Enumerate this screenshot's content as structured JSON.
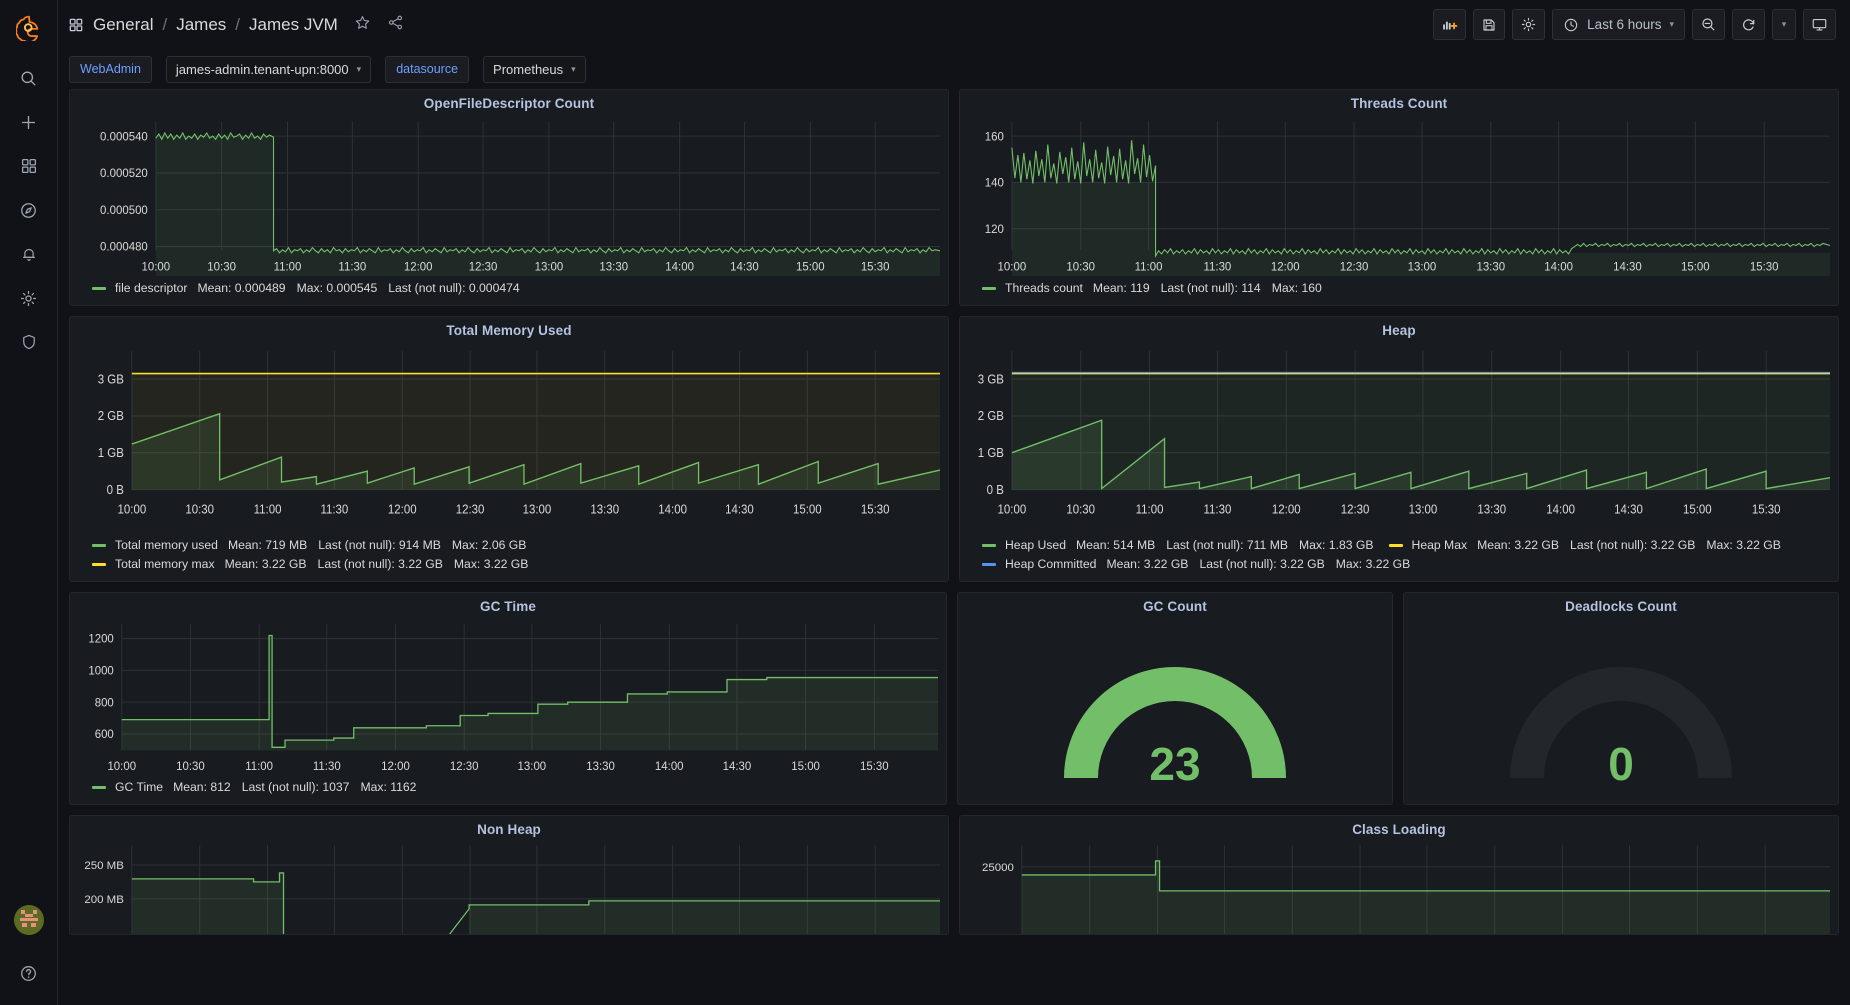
{
  "sidebar": {
    "brand_icon": "grafana-logo-icon",
    "items": [
      {
        "icon": "search-icon",
        "label": "Search"
      },
      {
        "icon": "plus-icon",
        "label": "Create"
      },
      {
        "icon": "dashboards-grid-icon",
        "label": "Dashboards"
      },
      {
        "icon": "compass-explore-icon",
        "label": "Explore"
      },
      {
        "icon": "bell-alerting-icon",
        "label": "Alerting"
      },
      {
        "icon": "gear-configuration-icon",
        "label": "Configuration"
      },
      {
        "icon": "shield-server-admin-icon",
        "label": "Server Admin"
      }
    ],
    "avatar": {
      "icon": "user-avatar",
      "label": "Profile"
    },
    "help": {
      "icon": "help-circle-icon",
      "label": "Help"
    }
  },
  "header": {
    "folder_icon": "dashboard-grid-icon",
    "breadcrumb": [
      "General",
      "James",
      "James JVM"
    ],
    "separator": "/",
    "star_icon": "star-icon",
    "share_icon": "share-icon",
    "toolbar": {
      "add_panel_icon": "add-panel-icon",
      "save_icon": "save-dashboard-icon",
      "settings_icon": "dashboard-settings-gear-icon",
      "time_icon": "clock-icon",
      "time_range": "Last 6 hours",
      "time_caret": "chevron-down-icon",
      "zoom_out_icon": "zoom-out-magnifier-icon",
      "refresh_icon": "refresh-cycle-icon",
      "refresh_caret": "chevron-down-icon",
      "kiosk_icon": "tv-kiosk-icon"
    }
  },
  "variables": [
    {
      "label": "WebAdmin",
      "value": "james-admin.tenant-upn:8000",
      "caret": "chevron-down-icon"
    },
    {
      "label": "datasource",
      "value": "Prometheus",
      "caret": "chevron-down-icon"
    }
  ],
  "chart_data": [
    {
      "type": "line",
      "title": "OpenFileDescriptor Count",
      "xlabel": "",
      "ylabel": "",
      "x_ticks": [
        "10:00",
        "10:30",
        "11:00",
        "11:30",
        "12:00",
        "12:30",
        "13:00",
        "13:30",
        "14:00",
        "14:30",
        "15:00",
        "15:30"
      ],
      "y_ticks": [
        "0.000480",
        "0.000500",
        "0.000520",
        "0.000540"
      ],
      "ylim": [
        0.00047,
        0.000548
      ],
      "grid": true,
      "legend_position": "bottom",
      "series": [
        {
          "name": "file descriptor",
          "color": "#73bf69",
          "stats": [
            {
              "label": "Mean",
              "value": "0.000489"
            },
            {
              "label": "Max",
              "value": "0.000545"
            },
            {
              "label": "Last (not null)",
              "value": "0.000474"
            }
          ],
          "note": "flat ~0.000540 noisy until 11:07, step down to ~0.000476 noisy through 15:45"
        }
      ]
    },
    {
      "type": "line",
      "title": "Threads Count",
      "xlabel": "",
      "ylabel": "",
      "x_ticks": [
        "10:00",
        "10:30",
        "11:00",
        "11:30",
        "12:00",
        "12:30",
        "13:00",
        "13:30",
        "14:00",
        "14:30",
        "15:00",
        "15:30"
      ],
      "y_ticks": [
        "120",
        "140",
        "160"
      ],
      "ylim": [
        105,
        165
      ],
      "grid": true,
      "legend_position": "bottom",
      "series": [
        {
          "name": "Threads count",
          "color": "#73bf69",
          "stats": [
            {
              "label": "Mean",
              "value": "119"
            },
            {
              "label": "Last (not null)",
              "value": "114"
            },
            {
              "label": "Max",
              "value": "160"
            }
          ],
          "note": "spiky 140-160 until 11:07, drop to ~110 flat, small step up to ~114 at 13:50"
        }
      ]
    },
    {
      "type": "area",
      "title": "Total Memory Used",
      "xlabel": "",
      "ylabel": "",
      "x_ticks": [
        "10:00",
        "10:30",
        "11:00",
        "11:30",
        "12:00",
        "12:30",
        "13:00",
        "13:30",
        "14:00",
        "14:30",
        "15:00",
        "15:30"
      ],
      "y_ticks": [
        "0 B",
        "1 GB",
        "2 GB",
        "3 GB"
      ],
      "ylim": [
        0,
        3.45
      ],
      "grid": true,
      "legend_position": "bottom",
      "series": [
        {
          "name": "Total memory used",
          "color": "#73bf69",
          "stats": [
            {
              "label": "Mean",
              "value": "719 MB"
            },
            {
              "label": "Last (not null)",
              "value": "914 MB"
            },
            {
              "label": "Max",
              "value": "2.06 GB"
            }
          ],
          "note": "GC sawtooth, two large teeth to 2.06 GB and 1.85 GB, then smaller teeth ~0.6-0.9 GB"
        },
        {
          "name": "Total memory max",
          "color": "#fade2a",
          "stats": [
            {
              "label": "Mean",
              "value": "3.22 GB"
            },
            {
              "label": "Last (not null)",
              "value": "3.22 GB"
            },
            {
              "label": "Max",
              "value": "3.22 GB"
            }
          ],
          "note": "flat line at 3.22 GB"
        }
      ]
    },
    {
      "type": "area",
      "title": "Heap",
      "xlabel": "",
      "ylabel": "",
      "x_ticks": [
        "10:00",
        "10:30",
        "11:00",
        "11:30",
        "12:00",
        "12:30",
        "13:00",
        "13:30",
        "14:00",
        "14:30",
        "15:00",
        "15:30"
      ],
      "y_ticks": [
        "0 B",
        "1 GB",
        "2 GB",
        "3 GB"
      ],
      "ylim": [
        0,
        3.45
      ],
      "grid": true,
      "legend_position": "bottom",
      "series": [
        {
          "name": "Heap Used",
          "color": "#73bf69",
          "stats": [
            {
              "label": "Mean",
              "value": "514 MB"
            },
            {
              "label": "Last (not null)",
              "value": "711 MB"
            },
            {
              "label": "Max",
              "value": "1.83 GB"
            }
          ],
          "note": "GC sawtooth peaking 1.83 GB then smaller teeth"
        },
        {
          "name": "Heap Max",
          "color": "#fade2a",
          "stats": [
            {
              "label": "Mean",
              "value": "3.22 GB"
            },
            {
              "label": "Last (not null)",
              "value": "3.22 GB"
            },
            {
              "label": "Max",
              "value": "3.22 GB"
            }
          ],
          "note": "flat line at 3.22 GB"
        },
        {
          "name": "Heap Committed",
          "color": "#5794f2",
          "stats": [
            {
              "label": "Mean",
              "value": "3.22 GB"
            },
            {
              "label": "Last (not null)",
              "value": "3.22 GB"
            },
            {
              "label": "Max",
              "value": "3.22 GB"
            }
          ],
          "note": "flat line at 3.22 GB overlapping Heap Max"
        }
      ]
    },
    {
      "type": "area",
      "title": "GC Time",
      "xlabel": "",
      "ylabel": "",
      "x_ticks": [
        "10:00",
        "10:30",
        "11:00",
        "11:30",
        "12:00",
        "12:30",
        "13:00",
        "13:30",
        "14:00",
        "14:30",
        "15:00",
        "15:30"
      ],
      "y_ticks": [
        "600",
        "800",
        "1000",
        "1200"
      ],
      "ylim": [
        500,
        1250
      ],
      "grid": true,
      "legend_position": "bottom",
      "series": [
        {
          "name": "GC Time",
          "color": "#73bf69",
          "stats": [
            {
              "label": "Mean",
              "value": "812"
            },
            {
              "label": "Last (not null)",
              "value": "1037"
            },
            {
              "label": "Max",
              "value": "1162"
            }
          ],
          "note": "flat ~690, spike to 1162 at 11:08, drop to 540, then rising staircase to ~1037"
        }
      ]
    },
    {
      "type": "gauge",
      "title": "GC Count",
      "value": 23,
      "display_value": "23",
      "min": 0,
      "max": 23,
      "fill_fraction": 1.0,
      "color": "#73bf69",
      "track_color": "#23262b"
    },
    {
      "type": "gauge",
      "title": "Deadlocks Count",
      "value": 0,
      "display_value": "0",
      "min": 0,
      "max": 100,
      "fill_fraction": 0.0,
      "color": "#73bf69",
      "track_color": "#23262b"
    },
    {
      "type": "area",
      "title": "Non Heap",
      "xlabel": "",
      "ylabel": "",
      "x_ticks": [],
      "y_ticks": [
        "200 MB",
        "250 MB"
      ],
      "ylim": [
        150,
        275
      ],
      "grid": true,
      "legend_position": "bottom",
      "series": [
        {
          "name": "Non Heap",
          "color": "#73bf69",
          "stats": [],
          "note": "flat ~228 MB until 11:07, spike to 242, drop below 200 MB then rising"
        }
      ]
    },
    {
      "type": "area",
      "title": "Class Loading",
      "xlabel": "",
      "ylabel": "",
      "x_ticks": [],
      "y_ticks": [
        "25000"
      ],
      "ylim": [
        20000,
        27000
      ],
      "grid": true,
      "legend_position": "bottom",
      "series": [
        {
          "name": "Class Loading",
          "color": "#73bf69",
          "stats": [],
          "note": "flat ~24700 until 11:07, brief spike to 25200, then flat lower ~23800"
        }
      ]
    }
  ],
  "colors": {
    "page_bg": "#111217",
    "panel_bg": "#181b1f",
    "panel_border": "#23262b",
    "title_text": "#b4c3e0",
    "green": "#73bf69",
    "yellow": "#fade2a",
    "blue": "#5794f2",
    "variable_label": "#6e9fff",
    "time_text": "#b9c0cc"
  }
}
